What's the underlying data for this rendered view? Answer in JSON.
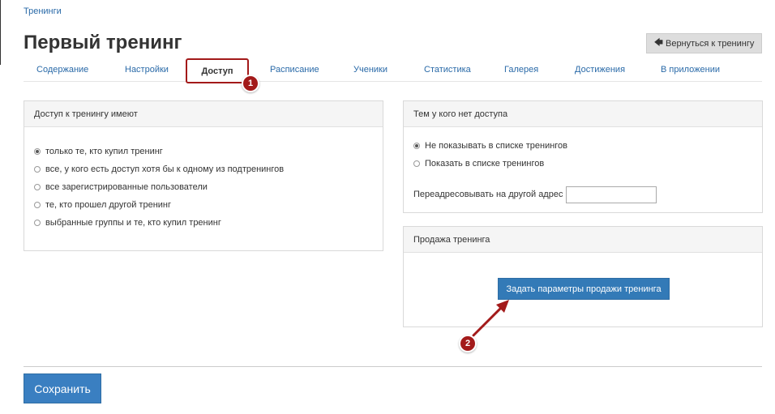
{
  "breadcrumb": "Тренинги",
  "title": "Первый тренинг",
  "back_button": "Вернуться к тренингу",
  "tabs": [
    "Содержание",
    "Настройки",
    "Доступ",
    "Расписание",
    "Ученики",
    "Статистика",
    "Галерея",
    "Достижения",
    "В приложении"
  ],
  "active_tab": "Доступ",
  "markers": [
    "1",
    "2"
  ],
  "access_panel": {
    "title": "Доступ к тренингу имеют",
    "options": [
      "только те, кто купил тренинг",
      "все, у кого есть доступ хотя бы к одному из подтренингов",
      "все зарегистрированные пользователи",
      "те, кто прошел другой тренинг",
      "выбранные группы и те, кто купил тренинг"
    ],
    "selected": "только те, кто купил тренинг"
  },
  "no_access_panel": {
    "title": "Тем у кого нет доступа",
    "options": [
      "Не показывать в списке тренингов",
      "Показать в списке тренингов"
    ],
    "selected": "Не показывать в списке тренингов",
    "redirect_label": "Переадресовывать на другой адрес",
    "redirect_value": ""
  },
  "sale_panel": {
    "title": "Продажа тренинга",
    "button": "Задать параметры продажи тренинга"
  },
  "save_button": "Сохранить",
  "colors": {
    "link": "#2a6aa8",
    "primary_button": "#337ab7",
    "marker": "#a31a1a"
  }
}
